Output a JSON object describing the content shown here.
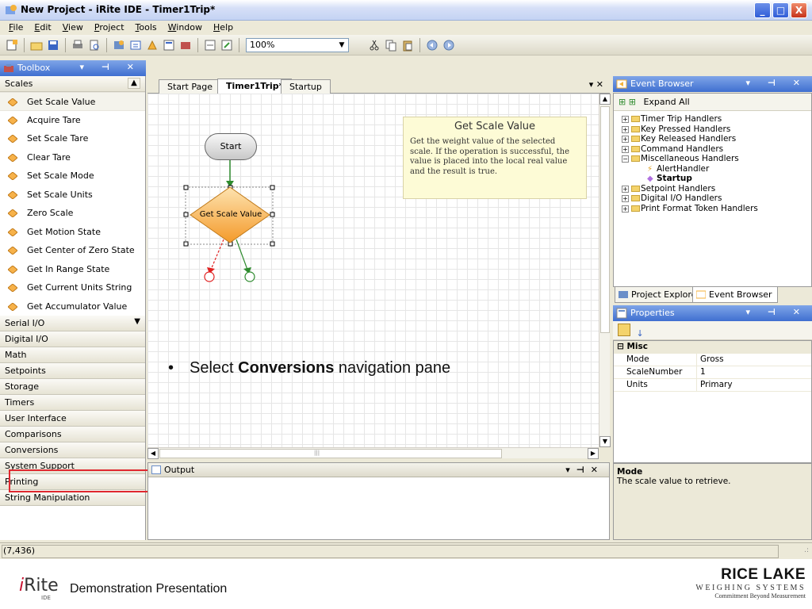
{
  "window": {
    "title": "New Project - iRite IDE - Timer1Trip*",
    "controls": [
      "_",
      "□",
      "X"
    ]
  },
  "menu": [
    {
      "u": "F",
      "rest": "ile"
    },
    {
      "u": "E",
      "rest": "dit"
    },
    {
      "u": "V",
      "rest": "iew"
    },
    {
      "u": "P",
      "rest": "roject"
    },
    {
      "u": "T",
      "rest": "ools"
    },
    {
      "u": "W",
      "rest": "indow"
    },
    {
      "u": "H",
      "rest": "elp"
    }
  ],
  "toolbar": {
    "zoom": "100%"
  },
  "toolbox": {
    "header": "Toolbox",
    "open_category": "Scales",
    "tools": [
      "Get Scale Value",
      "Acquire Tare",
      "Set Scale Tare",
      "Clear Tare",
      "Set Scale Mode",
      "Set Scale Units",
      "Zero Scale",
      "Get Motion State",
      "Get Center of Zero State",
      "Get In Range State",
      "Get Current Units String",
      "Get Accumulator Value"
    ],
    "categories": [
      "Serial I/O",
      "Digital I/O",
      "Math",
      "Setpoints",
      "Storage",
      "Timers",
      "User Interface",
      "Comparisons",
      "Conversions",
      "System Support",
      "Printing",
      "String Manipulation"
    ]
  },
  "editor": {
    "tabs": [
      "Start Page",
      "Timer1Trip*",
      "Startup"
    ],
    "active_tab": "Timer1Trip*",
    "start_node": "Start",
    "action_node": "Get Scale Value",
    "tooltip": {
      "title": "Get Scale Value",
      "body": "Get the weight value of the selected scale. If the operation is successful, the value is placed into the local real value and the result is true."
    },
    "instruction": {
      "bullet": "•",
      "prefix": "Select ",
      "bold": "Conversions",
      "suffix": " navigation pane"
    }
  },
  "output": {
    "header": "Output"
  },
  "event_browser": {
    "header": "Event Browser",
    "expand_all": "Expand All",
    "handlers": [
      "Timer Trip Handlers",
      "Key Pressed Handlers",
      "Key Released Handlers",
      "Command Handlers",
      "Miscellaneous Handlers"
    ],
    "misc_children": [
      "AlertHandler",
      "Startup"
    ],
    "handlers_after": [
      "Setpoint Handlers",
      "Digital I/O Handlers",
      "Print Format Token Handlers"
    ],
    "tabs": [
      "Project Explorer",
      "Event Browser"
    ]
  },
  "properties": {
    "header": "Properties",
    "category": "Misc",
    "rows": [
      {
        "key": "Mode",
        "value": "Gross"
      },
      {
        "key": "ScaleNumber",
        "value": "1"
      },
      {
        "key": "Units",
        "value": "Primary"
      }
    ],
    "desc_title": "Mode",
    "desc_text": "The scale value to retrieve."
  },
  "status": {
    "coords": "(7,436)"
  },
  "slide_footer": {
    "logo_text": "Rite",
    "logo_sub": "IDE",
    "presentation_label": "Demonstration Presentation",
    "brand": "RICE LAKE",
    "brand_sub": "WEIGHING SYSTEMS",
    "tagline": "Commitment Beyond Measurement"
  },
  "colors": {
    "titlebar_accent": "#3f6fd0",
    "highlight_box": "#e0282f",
    "diamond_fill": "#f7b24a",
    "tooltip_bg": "#fdfbd6"
  }
}
